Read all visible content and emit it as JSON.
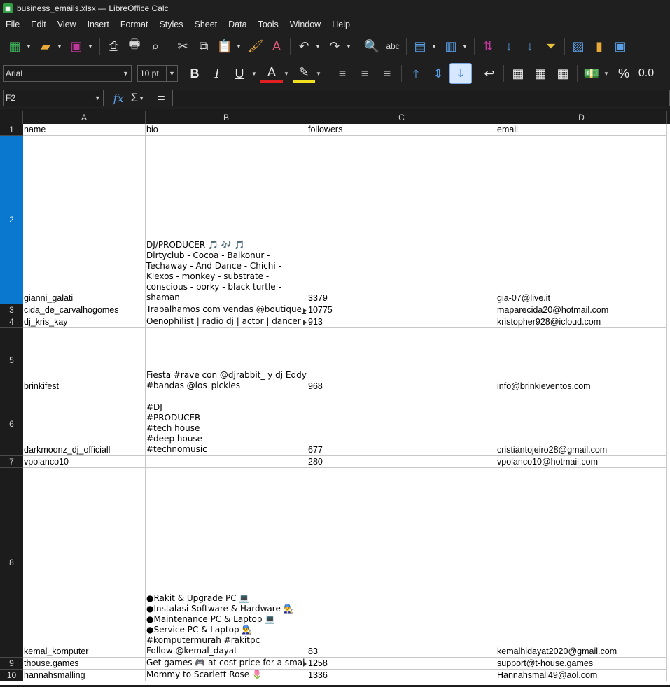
{
  "window": {
    "title": "business_emails.xlsx — LibreOffice Calc",
    "app_icon": "calc-icon"
  },
  "menu": [
    "File",
    "Edit",
    "View",
    "Insert",
    "Format",
    "Styles",
    "Sheet",
    "Data",
    "Tools",
    "Window",
    "Help"
  ],
  "toolbar": {
    "font_name": "Arial",
    "font_size": "10 pt",
    "bold": "B",
    "italic": "I",
    "underline": "U",
    "font_color_label": "A",
    "percent": "%",
    "decimal": "0.0",
    "spell": "abc"
  },
  "formula_bar": {
    "name_box": "F2",
    "fx": "fx",
    "sigma": "Σ",
    "equals": "=",
    "content": ""
  },
  "columns": [
    "A",
    "B",
    "C",
    "D"
  ],
  "rows": [
    {
      "num": "1",
      "name": "name",
      "bio": "bio",
      "followers": "followers",
      "email": "email"
    },
    {
      "num": "2",
      "name": "gianni_galati",
      "bio": "DJ/PRODUCER 🎵 🎶 🎵\nDirtyclub - Cocoa - Baikonur -\nTechaway - And Dance - Chichi -\nKlexos - monkey - substrate -\nconscious - porky - black turtle -\nshaman",
      "followers": "3379",
      "email": "gia-07@live.it"
    },
    {
      "num": "3",
      "name": "cida_de_carvalhogomes",
      "bio": "Trabalhamos com vendas @boutique_",
      "followers": "10775",
      "email": "maparecida20@hotmail.com"
    },
    {
      "num": "4",
      "name": "dj_kris_kay",
      "bio": "Oenophilist | radio dj | actor | dancer",
      "followers": "913",
      "email": "kristopher928@icloud.com"
    },
    {
      "num": "5",
      "name": "brinkifest",
      "bio": "Fiesta #rave con @djrabbit_ y dj Eddy\n#bandas @los_pickles",
      "followers": "968",
      "email": "info@brinkieventos.com"
    },
    {
      "num": "6",
      "name": "darkmoonz_dj_officiall",
      "bio": "#DJ\n#PRODUCER\n#tech house\n#deep house\n#technomusic",
      "followers": "677",
      "email": "cristiantojeiro28@gmail.com"
    },
    {
      "num": "7",
      "name": "vpolanco10",
      "bio": "",
      "followers": "280",
      "email": "vpolanco10@hotmail.com"
    },
    {
      "num": "8",
      "name": "kemal_komputer",
      "bio": "●Rakit & Upgrade PC 💻\n●Instalasi Software & Hardware 👨‍🔧\n●Maintenance PC & Laptop 💻\n●Service PC & Laptop 👨‍🔧\n#komputermurah #rakitpc\nFollow @kemal_dayat",
      "followers": "83",
      "email": "kemalhidayat2020@gmail.com"
    },
    {
      "num": "9",
      "name": "thouse.games",
      "bio": "Get games 🎮 at cost price for a smal",
      "followers": "1258",
      "email": "support@t-house.games"
    },
    {
      "num": "10",
      "name": "hannahsmalling",
      "bio": "Mommy to Scarlett Rose 🌷",
      "followers": "1336",
      "email": "Hannahsmall49@aol.com"
    }
  ],
  "colors": {
    "selected_row_header": "#0b78d0",
    "background": "#1f1f1f"
  }
}
